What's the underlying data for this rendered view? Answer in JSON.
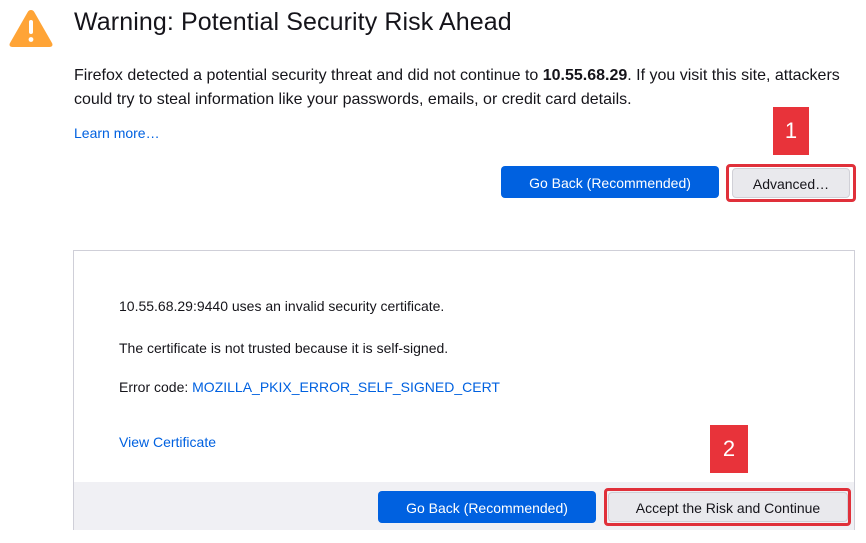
{
  "header": {
    "icon": "warning-triangle-icon",
    "title": "Warning: Potential Security Risk Ahead"
  },
  "description": {
    "part1": "Firefox detected a potential security threat and did not continue to ",
    "host": "10.55.68.29",
    "part2": ". If you visit this site, attackers could try to steal information like your passwords, emails, or credit card details."
  },
  "learn_more": "Learn more…",
  "buttons": {
    "go_back": "Go Back (Recommended)",
    "advanced": "Advanced…"
  },
  "advanced_panel": {
    "line1": "10.55.68.29:9440 uses an invalid security certificate.",
    "line2": "The certificate is not trusted because it is self-signed.",
    "error_code_label": "Error code: ",
    "error_code": "MOZILLA_PKIX_ERROR_SELF_SIGNED_CERT",
    "view_certificate": "View Certificate",
    "go_back": "Go Back (Recommended)",
    "accept": "Accept the Risk and Continue"
  },
  "annotations": {
    "step1": "1",
    "step2": "2",
    "highlight_color": "#e0303a"
  },
  "colors": {
    "accent": "#0061e0",
    "warning": "#ffa436"
  }
}
